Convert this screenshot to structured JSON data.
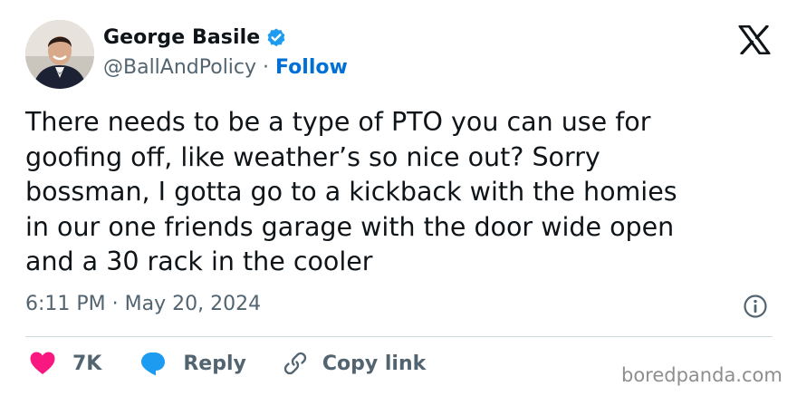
{
  "author": {
    "display_name": "George Basile",
    "handle": "@BallAndPolicy",
    "separator": "·",
    "follow_label": "Follow",
    "verified_color": "#1d9bf0",
    "avatar_icon": "profile-photo"
  },
  "tweet": {
    "text": "There needs to be a type of PTO you can use for\ngoofing off, like weather’s so nice out? Sorry\nbossman, I gotta go to a kickback with the homies\nin our one friends garage with the door wide open\nand a 30 rack in the cooler",
    "time": "6:11 PM",
    "separator": "·",
    "date": "May 20, 2024"
  },
  "actions": {
    "like_count": "7K",
    "reply_label": "Reply",
    "copy_link_label": "Copy link",
    "like_color": "#f91880",
    "reply_color": "#1d9bf0"
  },
  "watermark": {
    "text": "boredpanda.com"
  }
}
